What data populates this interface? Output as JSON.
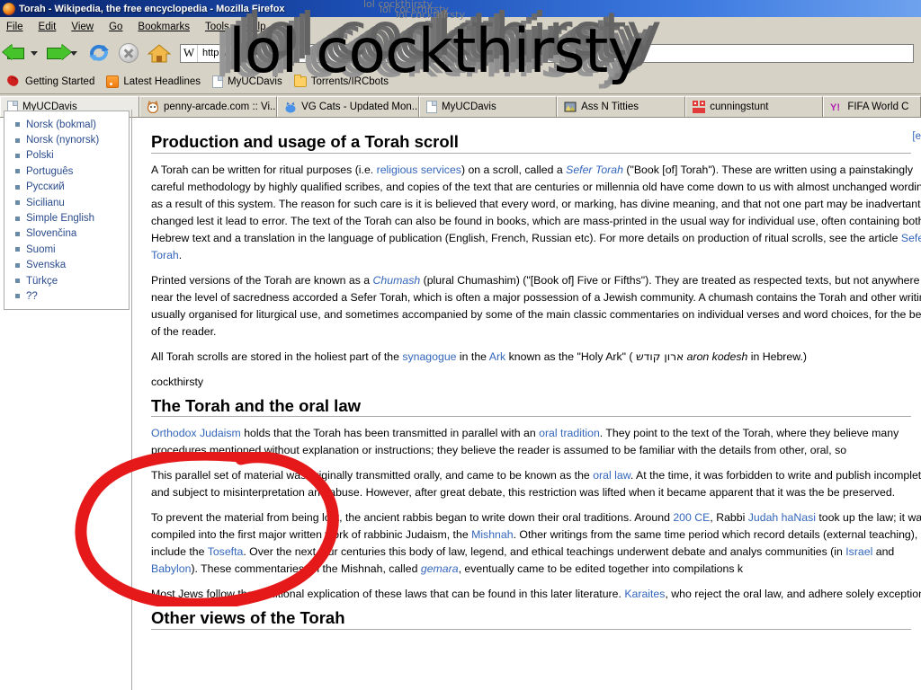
{
  "window": {
    "title": "Torah - Wikipedia, the free encyclopedia - Mozilla Firefox",
    "app_icon": "firefox-icon"
  },
  "menubar": {
    "items": [
      "File",
      "Edit",
      "View",
      "Go",
      "Bookmarks",
      "Tools",
      "Help"
    ]
  },
  "toolbar": {
    "back": "Back",
    "forward": "Forward",
    "reload": "Reload",
    "stop": "Stop",
    "home": "Home",
    "url_value": "http://",
    "url_placeholder": "Enter address",
    "url_icon_letter": "W"
  },
  "bookmarks": {
    "items": [
      {
        "label": "Getting Started",
        "icon": "bookmark-star-icon"
      },
      {
        "label": "Latest Headlines",
        "icon": "rss-feed-icon"
      },
      {
        "label": "MyUCDavis",
        "icon": "document-icon"
      },
      {
        "label": "Torrents/IRCbots",
        "icon": "folder-icon"
      }
    ]
  },
  "tabs": [
    {
      "label": "MyUCDavis",
      "icon": "document-icon",
      "active": true
    },
    {
      "label": "penny-arcade.com :: Vi...",
      "icon": "penny-arcade-icon",
      "active": false
    },
    {
      "label": "VG Cats - Updated Mon...",
      "icon": "vgcats-icon",
      "active": false
    },
    {
      "label": "MyUCDavis",
      "icon": "document-icon",
      "active": false
    },
    {
      "label": "Ass N Titties",
      "icon": "photo-icon",
      "active": false
    },
    {
      "label": "cunningstunt",
      "icon": "red-squares-icon",
      "active": false
    },
    {
      "label": "FIFA World C",
      "icon": "yahoo-icon",
      "active": false
    }
  ],
  "sidebar": {
    "languages": [
      "Norsk (bokmal)",
      "Norsk (nynorsk)",
      "Polski",
      "Português",
      "Русский",
      "Sicilianu",
      "Simple English",
      "Slovenčina",
      "Suomi",
      "Svenska",
      "Türkçe",
      "??"
    ]
  },
  "article": {
    "edit_link": "[e",
    "sections": [
      {
        "heading": "Production and usage of a Torah scroll",
        "paragraphs": [
          "A Torah can be written for ritual purposes (i.e. religious services) on a scroll, called a Sefer Torah (\"Book [of] Torah\"). These are written using a painstakingly careful methodology by highly qualified scribes, and copies of the text that are centuries or millennia old have come down to us with almost unchanged wording as a result of this system. The reason for such care is it is believed that every word, or marking, has divine meaning, and that not one part may be inadvertantly changed lest it lead to error. The text of the Torah can also be found in books, which are mass-printed in the usual way for individual use, often containing both the Hebrew text and a translation in the language of publication (English, French, Russian etc). For more details on production of ritual scrolls, see the article Sefer Torah.",
          "Printed versions of the Torah are known as a Chumash (plural Chumashim) (\"[Book of] Five or Fifths\"). They are treated as respected texts, but not anywhere near the level of sacredness accorded a Sefer Torah, which is often a major possession of a Jewish community. A chumash contains the Torah and other writings, usually organised for liturgical use, and sometimes accompanied by some of the main classic commentaries on individual verses and word choices, for the benefit of the reader.",
          "All Torah scrolls are stored in the holiest part of the synagogue in the Ark known as the \"Holy Ark\" ( ארון קודש aron kodesh in Hebrew.)",
          "cockthirsty"
        ]
      },
      {
        "heading": "The Torah and the oral law",
        "paragraphs": [
          "Orthodox Judaism holds that the Torah has been transmitted in parallel with an oral tradition. They point to the text of the Torah, where they believe many procedures mentioned without explanation or instructions; they believe the reader is assumed to be familiar with the details from other, oral, so",
          "This parallel set of material was originally transmitted orally, and came to be known as the oral law. At the time, it was forbidden to write and publish incomplete and subject to misinterpretation and abuse. However, after great debate, this restriction was lifted when it became apparent that it was the be preserved.",
          "To prevent the material from being lost, the ancient rabbis began to write down their oral traditions. Around 200 CE, Rabbi Judah haNasi took up the law; it was compiled into the first major written work of rabbinic Judaism, the Mishnah. Other writings from the same time period which record details (external teaching), and include the Tosefta. Over the next four centuries this body of law, legend, and ethical teachings underwent debate and analys communities (in Israel and Babylon). These commentaries on the Mishnah, called gemara, eventually came to be edited together into compilations k",
          "Most Jews follow the traditional explication of these laws that can be found in this later literature. Karaites, who reject the oral law, and adhere solely exception."
        ]
      },
      {
        "heading": "Other views of the Torah",
        "paragraphs": []
      }
    ]
  },
  "annotations": {
    "red_circle": {
      "color": "#e51919",
      "label": "red-circle-scribble"
    },
    "overlay_text": "lol cockthirsty",
    "overlay_small_text": "lol cockthirsty"
  }
}
